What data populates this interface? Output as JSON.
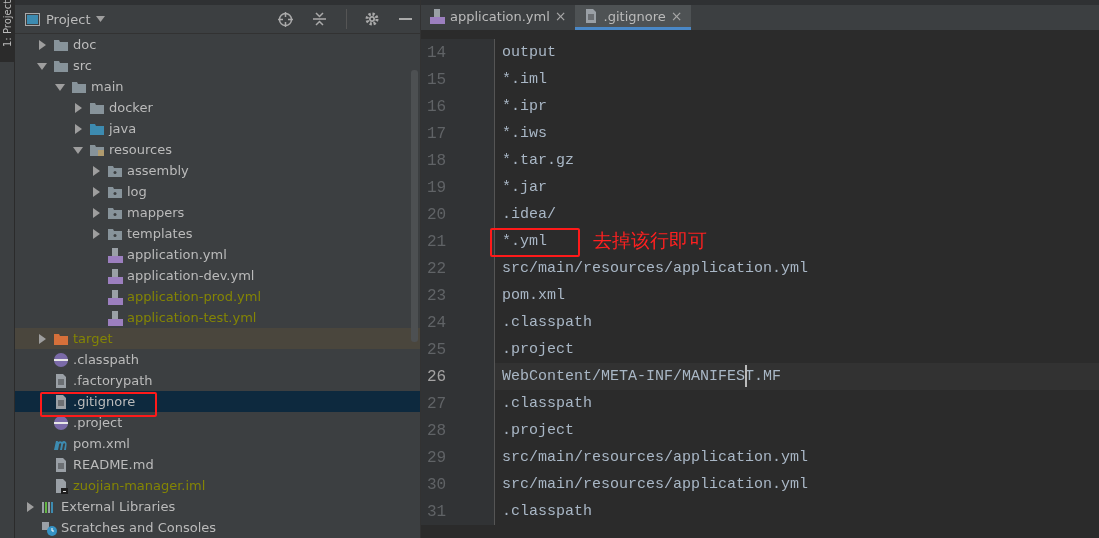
{
  "tool_strip": {
    "label": "1: Project"
  },
  "project_panel": {
    "title": "Project",
    "tree": [
      {
        "name": "doc",
        "kind": "folder",
        "expanded": false,
        "selected": false,
        "color": "#bbbbbb"
      },
      {
        "name": "src",
        "kind": "folder",
        "expanded": true,
        "selected": false,
        "color": "#bbbbbb",
        "children": [
          {
            "name": "main",
            "kind": "folder",
            "expanded": true,
            "selected": false,
            "color": "#bbbbbb",
            "children": [
              {
                "name": "docker",
                "kind": "folder",
                "expanded": false,
                "selected": false,
                "color": "#bbbbbb"
              },
              {
                "name": "java",
                "kind": "source-folder",
                "expanded": false,
                "selected": false,
                "color": "#bbbbbb"
              },
              {
                "name": "resources",
                "kind": "resource-folder",
                "expanded": true,
                "selected": false,
                "color": "#bbbbbb",
                "children": [
                  {
                    "name": "assembly",
                    "kind": "package-folder",
                    "expanded": false,
                    "selected": false,
                    "color": "#bbbbbb"
                  },
                  {
                    "name": "log",
                    "kind": "package-folder",
                    "expanded": false,
                    "selected": false,
                    "color": "#bbbbbb"
                  },
                  {
                    "name": "mappers",
                    "kind": "package-folder",
                    "expanded": false,
                    "selected": false,
                    "color": "#bbbbbb"
                  },
                  {
                    "name": "templates",
                    "kind": "package-folder",
                    "expanded": false,
                    "selected": false,
                    "color": "#bbbbbb"
                  },
                  {
                    "name": "application.yml",
                    "kind": "yml",
                    "selected": false,
                    "color": "#bbbbbb"
                  },
                  {
                    "name": "application-dev.yml",
                    "kind": "yml",
                    "selected": false,
                    "color": "#bbbbbb"
                  },
                  {
                    "name": "application-prod.yml",
                    "kind": "yml",
                    "selected": false,
                    "color": "#848504"
                  },
                  {
                    "name": "application-test.yml",
                    "kind": "yml",
                    "selected": false,
                    "color": "#848504"
                  }
                ]
              }
            ]
          }
        ]
      },
      {
        "name": "target",
        "kind": "excluded-folder",
        "expanded": false,
        "excluded": true,
        "selected": false,
        "color": "#848504"
      },
      {
        "name": ".classpath",
        "kind": "eclipse",
        "selected": false,
        "color": "#bbbbbb"
      },
      {
        "name": ".factorypath",
        "kind": "text",
        "selected": false,
        "color": "#bbbbbb"
      },
      {
        "name": ".gitignore",
        "kind": "text",
        "selected": true,
        "color": "#bbbbbb"
      },
      {
        "name": ".project",
        "kind": "eclipse",
        "selected": false,
        "color": "#bbbbbb"
      },
      {
        "name": "pom.xml",
        "kind": "maven",
        "selected": false,
        "color": "#bbbbbb"
      },
      {
        "name": "README.md",
        "kind": "text",
        "selected": false,
        "color": "#bbbbbb"
      },
      {
        "name": "zuojian-manager.iml",
        "kind": "iml",
        "selected": false,
        "color": "#848504"
      }
    ],
    "roots": [
      {
        "name": "External Libraries",
        "kind": "libraries",
        "expanded": false
      },
      {
        "name": "Scratches and Consoles",
        "kind": "scratches"
      }
    ]
  },
  "editor": {
    "tabs": [
      {
        "label": "application.yml",
        "kind": "yml",
        "selected": false,
        "close": "×"
      },
      {
        "label": ".gitignore",
        "kind": "text",
        "selected": true,
        "close": "×"
      }
    ],
    "lines": [
      {
        "number": "14",
        "text": "output",
        "current": false
      },
      {
        "number": "15",
        "text": "*.iml",
        "current": false
      },
      {
        "number": "16",
        "text": "*.ipr",
        "current": false
      },
      {
        "number": "17",
        "text": "*.iws",
        "current": false
      },
      {
        "number": "18",
        "text": "*.tar.gz",
        "current": false
      },
      {
        "number": "19",
        "text": "*.jar",
        "current": false
      },
      {
        "number": "20",
        "text": ".idea/",
        "current": false
      },
      {
        "number": "21",
        "text": "*.yml",
        "current": false,
        "annotation": "去掉该行即可"
      },
      {
        "number": "22",
        "text": "src/main/resources/application.yml",
        "current": false
      },
      {
        "number": "23",
        "text": "pom.xml",
        "current": false
      },
      {
        "number": "24",
        "text": ".classpath",
        "current": false
      },
      {
        "number": "25",
        "text": ".project",
        "current": false
      },
      {
        "number": "26",
        "text": "WebContent/META-INF/MANIFEST.MF",
        "current": true
      },
      {
        "number": "27",
        "text": ".classpath",
        "current": false
      },
      {
        "number": "28",
        "text": ".project",
        "current": false
      },
      {
        "number": "29",
        "text": "src/main/resources/application.yml",
        "current": false
      },
      {
        "number": "30",
        "text": "src/main/resources/application.yml",
        "current": false
      },
      {
        "number": "31",
        "text": ".classpath",
        "current": false
      }
    ]
  }
}
